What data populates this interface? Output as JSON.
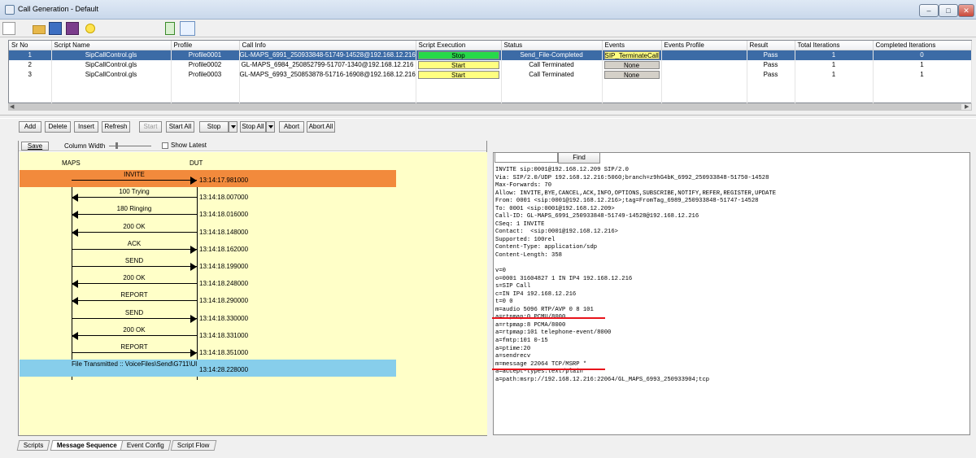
{
  "window": {
    "title": "Call Generation  - Default",
    "min": "–",
    "max": "□",
    "close": "✕"
  },
  "grid": {
    "columns": [
      "Sr No",
      "Script Name",
      "Profile",
      "Call Info",
      "Script Execution",
      "Status",
      "Events",
      "Events Profile",
      "Result",
      "Total Iterations",
      "Completed Iterations"
    ],
    "rows": [
      {
        "sr": "1",
        "script": "SipCallControl.gls",
        "profile": "Profile0001",
        "callinfo": "GL-MAPS_6991_250933848-51749-14528@192.168.12.216",
        "exec": "Stop",
        "status": "Send_File-Completed",
        "events": "SIP_TerminateCall",
        "evprofile": "",
        "result": "Pass",
        "total": "1",
        "completed": "0"
      },
      {
        "sr": "2",
        "script": "SipCallControl.gls",
        "profile": "Profile0002",
        "callinfo": "GL-MAPS_6984_250852799-51707-1340@192.168.12.216",
        "exec": "Start",
        "status": "Call Terminated",
        "events": "None",
        "evprofile": "",
        "result": "Pass",
        "total": "1",
        "completed": "1"
      },
      {
        "sr": "3",
        "script": "SipCallControl.gls",
        "profile": "Profile0003",
        "callinfo": "GL-MAPS_6993_250853878-51716-16908@192.168.12.216",
        "exec": "Start",
        "status": "Call Terminated",
        "events": "None",
        "evprofile": "",
        "result": "Pass",
        "total": "1",
        "completed": "1"
      }
    ]
  },
  "actions": {
    "add": "Add",
    "delete": "Delete",
    "insert": "Insert",
    "refresh": "Refresh",
    "start": "Start",
    "start_all": "Start All",
    "stop": "Stop",
    "stop_all": "Stop All",
    "abort": "Abort",
    "abort_all": "Abort All"
  },
  "seq_toolbar": {
    "save": "Save",
    "column_width": "Column Width",
    "show_latest": "Show Latest"
  },
  "sequence": {
    "left_label": "MAPS",
    "right_label": "DUT",
    "messages": [
      {
        "label": "INVITE",
        "time": "13:14:17.981000",
        "dir": "right",
        "highlight": "orange"
      },
      {
        "label": "100  Trying",
        "time": "13:14:18.007000",
        "dir": "left",
        "highlight": ""
      },
      {
        "label": "180  Ringing",
        "time": "13:14:18.016000",
        "dir": "left",
        "highlight": ""
      },
      {
        "label": "200  OK",
        "time": "13:14:18.148000",
        "dir": "left",
        "highlight": ""
      },
      {
        "label": "ACK",
        "time": "13:14:18.162000",
        "dir": "right",
        "highlight": ""
      },
      {
        "label": "SEND",
        "time": "13:14:18.199000",
        "dir": "right",
        "highlight": ""
      },
      {
        "label": "200 OK",
        "time": "13:14:18.248000",
        "dir": "left",
        "highlight": ""
      },
      {
        "label": "REPORT",
        "time": "13:14:18.290000",
        "dir": "left",
        "highlight": ""
      },
      {
        "label": "SEND",
        "time": "13:14:18.330000",
        "dir": "right",
        "highlight": ""
      },
      {
        "label": "200 OK",
        "time": "13:14:18.331000",
        "dir": "left",
        "highlight": ""
      },
      {
        "label": "REPORT",
        "time": "13:14:18.351000",
        "dir": "right",
        "highlight": ""
      },
      {
        "label": "File Transmitted :: VoiceFiles\\Send\\G711\\Ul",
        "time": "13:14:28.228000",
        "dir": "none",
        "highlight": "blue"
      }
    ]
  },
  "find": {
    "button": "Find",
    "value": ""
  },
  "sip_lines": [
    "INVITE sip:0001@192.168.12.209 SIP/2.0",
    "Via: SIP/2.0/UDP 192.168.12.216:5060;branch=z9hG4bK_6992_250933848-51750-14528",
    "Max-Forwards: 70",
    "Allow: INVITE,BYE,CANCEL,ACK,INFO,OPTIONS,SUBSCRIBE,NOTIFY,REFER,REGISTER,UPDATE",
    "From: 0001 <sip:0001@192.168.12.216>;tag=FromTag_6989_250933848-51747-14528",
    "To: 0001 <sip:0001@192.168.12.209>",
    "Call-ID: GL-MAPS_6991_250933848-51749-14528@192.168.12.216",
    "CSeq: 1 INVITE",
    "Contact:  <sip:0001@192.168.12.216>",
    "Supported: 100rel",
    "Content-Type: application/sdp",
    "Content-Length: 358",
    "",
    "v=0",
    "o=0001 31604827 1 IN IP4 192.168.12.216",
    "s=SIP Call",
    "c=IN IP4 192.168.12.216",
    "t=0 0",
    "m=audio 5096 RTP/AVP 0 8 101",
    "a=rtpmap:0 PCMU/8000",
    "a=rtpmap:8 PCMA/8000",
    "a=rtpmap:101 telephone-event/8000",
    "a=fmtp:101 0-15",
    "a=ptime:20",
    "a=sendrecv",
    "m=message 22064 TCP/MSRP *",
    "a=accept-types:text/plain",
    "a=path:msrp://192.168.12.216:22064/GL_MAPS_6993_250933904;tcp"
  ],
  "tabs": [
    "Scripts",
    "Message Sequence",
    "Event Config",
    "Script Flow"
  ],
  "active_tab": "Message Sequence",
  "colors": {
    "selected_row": "#3c6ba6",
    "stop_green": "#26d94a",
    "start_yellow": "#ffff80",
    "seq_bg": "#ffffc8",
    "invite_orange": "#f28a3c",
    "file_blue": "#87ceeb",
    "red_underline": "#e8141c"
  }
}
